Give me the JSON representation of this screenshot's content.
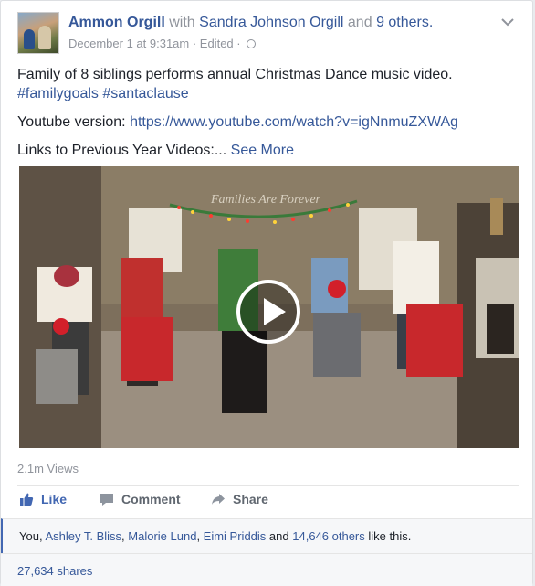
{
  "post": {
    "author": "Ammon Orgill",
    "with_word": "with",
    "tagged": "Sandra Johnson Orgill",
    "and_word": "and",
    "others": "9 others.",
    "timestamp": "December 1 at 9:31am",
    "edited": "· Edited ·",
    "line1": "Family of 8 siblings performs annual Christmas Dance music video.",
    "hashtag1": "#familygoals",
    "hashtag2": "#santaclause",
    "youtube_label": "Youtube version: ",
    "youtube_url": "https://www.youtube.com/watch?v=igNnmuZXWAg",
    "links_label": "Links to Previous Year Videos:...",
    "see_more": "See More",
    "video_wall_text": "Families Are Forever"
  },
  "video": {
    "views": "2.1m Views"
  },
  "actions": {
    "like": "Like",
    "comment": "Comment",
    "share": "Share"
  },
  "likes": {
    "you": "You,",
    "liker1": "Ashley T. Bliss",
    "liker2": "Malorie Lund",
    "liker3": "Eimi Priddis",
    "and_word": "and",
    "others": "14,646 others",
    "suffix": "like this."
  },
  "shares": {
    "count": "27,634 shares"
  },
  "icons": {
    "privacy": "globe-icon",
    "menu": "chevron-down-icon",
    "like": "thumbs-up-icon",
    "comment": "comment-icon",
    "share": "share-arrow-icon",
    "play": "play-icon"
  },
  "colors": {
    "link": "#365899",
    "like_active": "#4267b2",
    "meta": "#90949c"
  }
}
